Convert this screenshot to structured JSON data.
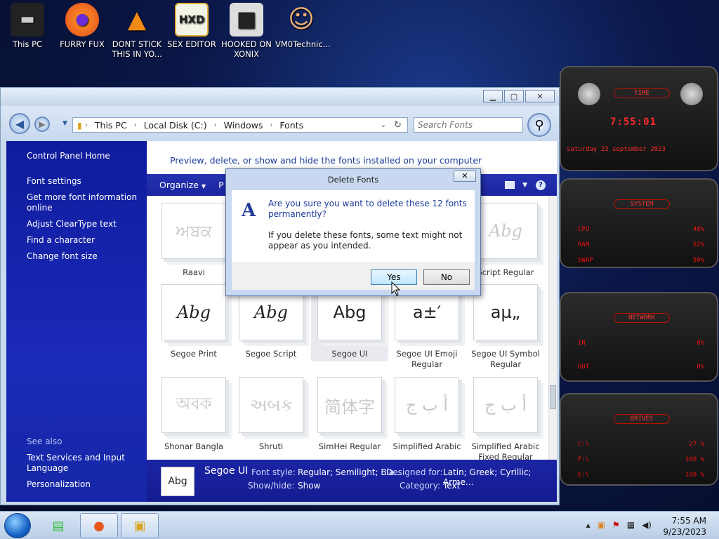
{
  "desktop": {
    "icons": [
      {
        "label": "This PC",
        "glyph": "▬"
      },
      {
        "label": "FURRY FUX",
        "glyph": "●"
      },
      {
        "label": "DONT STICK THIS IN YO...",
        "glyph": "▲"
      },
      {
        "label": "SEX EDITOR",
        "glyph": "HXD"
      },
      {
        "label": "HOOKED ON XONIX",
        "glyph": "■"
      },
      {
        "label": "VM0Technic...",
        "glyph": "☺"
      }
    ]
  },
  "explorer": {
    "breadcrumb": [
      "This PC",
      "Local Disk (C:)",
      "Windows",
      "Fonts"
    ],
    "search_placeholder": "Search Fonts",
    "sidebar": {
      "home": "Control Panel Home",
      "links": [
        "Font settings",
        "Get more font information online",
        "Adjust ClearType text",
        "Find a character",
        "Change font size"
      ],
      "see_also": "See also",
      "see_also_links": [
        "Text Services and Input Language",
        "Personalization"
      ]
    },
    "description": "Preview, delete, or show and hide the fonts installed on your computer",
    "toolbar": {
      "organize": "Organize",
      "partial": "P"
    },
    "fonts": [
      {
        "name": "Raavi",
        "preview": "ਅਬਕ",
        "faint": true
      },
      {
        "name": "Script Regular",
        "preview": "Abg",
        "faint": true
      },
      {
        "name": "Segoe Print",
        "preview": "Abg",
        "faint": false
      },
      {
        "name": "Segoe Script",
        "preview": "Abg",
        "faint": false
      },
      {
        "name": "Segoe UI",
        "preview": "Abg",
        "faint": false
      },
      {
        "name": "Segoe UI Emoji Regular",
        "preview": "a±′",
        "faint": false
      },
      {
        "name": "Segoe UI Symbol Regular",
        "preview": "aµ„",
        "faint": false
      },
      {
        "name": "Shonar Bangla",
        "preview": "অবক",
        "faint": true
      },
      {
        "name": "Shruti",
        "preview": "અબક",
        "faint": true
      },
      {
        "name": "SimHei Regular",
        "preview": "简体字",
        "faint": true
      },
      {
        "name": "Simplified Arabic",
        "preview": "أ ب ج",
        "faint": true
      },
      {
        "name": "Simplified Arabic Fixed Regular",
        "preview": "أ ب ج",
        "faint": true
      }
    ],
    "details": {
      "preview": "Abg",
      "name": "Segoe UI",
      "font_style_label": "Font style:",
      "font_style_value": "Regular; Semilight; Bla...",
      "designed_for_label": "Designed for:",
      "designed_for_value": "Latin; Greek; Cyrillic; Arme...",
      "show_hide_label": "Show/hide:",
      "show_hide_value": "Show",
      "category_label": "Category:",
      "category_value": "Text"
    }
  },
  "dialog": {
    "title": "Delete Fonts",
    "question": "Are you sure you want to delete these 12 fonts permanently?",
    "message": "If you delete these fonts, some text might not appear as you intended.",
    "yes": "Yes",
    "no": "No"
  },
  "gadget": {
    "time_title": "TIME",
    "time": "7:55:01",
    "date": "saturday 23 september 2023",
    "system_title": "SYSTEM",
    "cpu_label": "CPU",
    "cpu_value": "48%",
    "ram_label": "RAM",
    "ram_value": "52%",
    "swap_label": "SWAP",
    "swap_value": "50%",
    "network_title": "NETWORK",
    "in_label": "IN",
    "in_value": "0%",
    "out_label": "OUT",
    "out_value": "0%",
    "drives_title": "DRIVES",
    "drives": [
      {
        "label": "C:\\",
        "value": "27 %"
      },
      {
        "label": "F:\\",
        "value": "100 %"
      },
      {
        "label": "E:\\",
        "value": "100 %"
      }
    ]
  },
  "taskbar": {
    "time": "7:55 AM",
    "date": "9/23/2023"
  }
}
